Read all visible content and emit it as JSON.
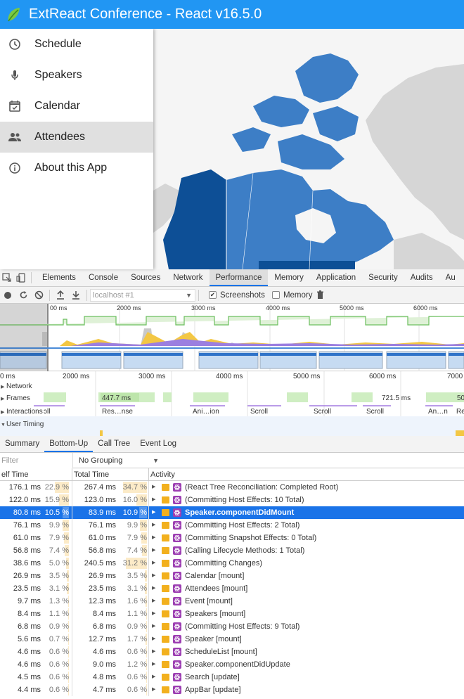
{
  "app": {
    "title": "ExtReact Conference - React v16.5.0",
    "colors": {
      "brand": "#2196f3",
      "selected_nav": "#e0e0e0",
      "map_dark": "#0d4f96",
      "map_mid": "#3d7ec6",
      "map_gray": "#d6d6d6"
    }
  },
  "nav": {
    "items": [
      {
        "label": "Schedule",
        "icon": "clock-icon",
        "selected": false
      },
      {
        "label": "Speakers",
        "icon": "microphone-icon",
        "selected": false
      },
      {
        "label": "Calendar",
        "icon": "calendar-check-icon",
        "selected": false
      },
      {
        "label": "Attendees",
        "icon": "people-icon",
        "selected": true
      },
      {
        "label": "About this App",
        "icon": "info-icon",
        "selected": false
      }
    ]
  },
  "devtools": {
    "tabs": [
      "Elements",
      "Console",
      "Sources",
      "Network",
      "Performance",
      "Memory",
      "Application",
      "Security",
      "Audits",
      "Au"
    ],
    "active_tab": "Performance",
    "toolbar": {
      "profile_select": "localhost #1",
      "screenshots_label": "Screenshots",
      "screenshots_checked": true,
      "memory_label": "Memory",
      "memory_checked": false
    },
    "overview_ticks": [
      "00 ms",
      "2000 ms",
      "3000 ms",
      "4000 ms",
      "5000 ms",
      "6000 ms"
    ],
    "timeline": {
      "ticks": [
        "0 ms",
        "2000 ms",
        "3000 ms",
        "4000 ms",
        "5000 ms",
        "6000 ms",
        "7000"
      ],
      "tracks": [
        "Network",
        "Frames",
        "Interactions",
        "User Timing"
      ],
      "frames_labels": [
        "447.7 ms",
        "721.5 ms",
        "50"
      ],
      "interactions_labels": [
        "ɔll",
        "Res…nse",
        "Ani…ion",
        "Scroll",
        "Scroll",
        "Scroll",
        "An…n",
        "Re"
      ]
    },
    "subtabs": [
      "Summary",
      "Bottom-Up",
      "Call Tree",
      "Event Log"
    ],
    "active_subtab": "Bottom-Up",
    "filter_placeholder": "Filter",
    "grouping": "No Grouping",
    "columns": [
      "elf Time",
      "Total Time",
      "Activity"
    ],
    "rows": [
      {
        "self": "176.1 ms",
        "self_pct": "22.9 %",
        "total": "267.4 ms",
        "total_pct": "34.7 %",
        "activity": "(React Tree Reconciliation: Completed Root)",
        "selected": false
      },
      {
        "self": "122.0 ms",
        "self_pct": "15.9 %",
        "total": "123.0 ms",
        "total_pct": "16.0 %",
        "activity": "(Committing Host Effects: 10 Total)",
        "selected": false
      },
      {
        "self": "80.8 ms",
        "self_pct": "10.5 %",
        "total": "83.9 ms",
        "total_pct": "10.9 %",
        "activity": "Speaker.componentDidMount",
        "selected": true
      },
      {
        "self": "76.1 ms",
        "self_pct": "9.9 %",
        "total": "76.1 ms",
        "total_pct": "9.9 %",
        "activity": "(Committing Host Effects: 2 Total)",
        "selected": false
      },
      {
        "self": "61.0 ms",
        "self_pct": "7.9 %",
        "total": "61.0 ms",
        "total_pct": "7.9 %",
        "activity": "(Committing Snapshot Effects: 0 Total)",
        "selected": false
      },
      {
        "self": "56.8 ms",
        "self_pct": "7.4 %",
        "total": "56.8 ms",
        "total_pct": "7.4 %",
        "activity": "(Calling Lifecycle Methods: 1 Total)",
        "selected": false
      },
      {
        "self": "38.6 ms",
        "self_pct": "5.0 %",
        "total": "240.5 ms",
        "total_pct": "31.2 %",
        "activity": "(Committing Changes)",
        "selected": false
      },
      {
        "self": "26.9 ms",
        "self_pct": "3.5 %",
        "total": "26.9 ms",
        "total_pct": "3.5 %",
        "activity": "Calendar [mount]",
        "selected": false
      },
      {
        "self": "23.5 ms",
        "self_pct": "3.1 %",
        "total": "23.5 ms",
        "total_pct": "3.1 %",
        "activity": "Attendees [mount]",
        "selected": false
      },
      {
        "self": "9.7 ms",
        "self_pct": "1.3 %",
        "total": "12.3 ms",
        "total_pct": "1.6 %",
        "activity": "Event [mount]",
        "selected": false
      },
      {
        "self": "8.4 ms",
        "self_pct": "1.1 %",
        "total": "8.4 ms",
        "total_pct": "1.1 %",
        "activity": "Speakers [mount]",
        "selected": false
      },
      {
        "self": "6.8 ms",
        "self_pct": "0.9 %",
        "total": "6.8 ms",
        "total_pct": "0.9 %",
        "activity": "(Committing Host Effects: 9 Total)",
        "selected": false
      },
      {
        "self": "5.6 ms",
        "self_pct": "0.7 %",
        "total": "12.7 ms",
        "total_pct": "1.7 %",
        "activity": "Speaker [mount]",
        "selected": false
      },
      {
        "self": "4.6 ms",
        "self_pct": "0.6 %",
        "total": "4.6 ms",
        "total_pct": "0.6 %",
        "activity": "ScheduleList [mount]",
        "selected": false
      },
      {
        "self": "4.6 ms",
        "self_pct": "0.6 %",
        "total": "9.0 ms",
        "total_pct": "1.2 %",
        "activity": "Speaker.componentDidUpdate",
        "selected": false
      },
      {
        "self": "4.5 ms",
        "self_pct": "0.6 %",
        "total": "4.8 ms",
        "total_pct": "0.6 %",
        "activity": "Search [update]",
        "selected": false
      },
      {
        "self": "4.4 ms",
        "self_pct": "0.6 %",
        "total": "4.7 ms",
        "total_pct": "0.6 %",
        "activity": "AppBar [update]",
        "selected": false
      }
    ]
  }
}
